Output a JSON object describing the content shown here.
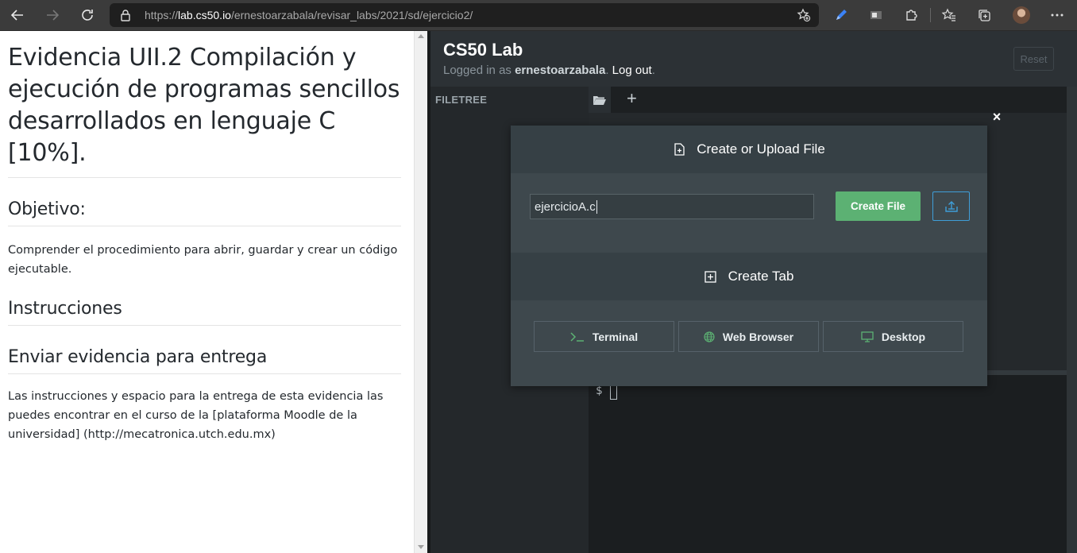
{
  "browser": {
    "url_prefix": "https://",
    "url_host": "lab.cs50.io",
    "url_path": "/ernestoarzabala/revisar_labs/2021/sd/ejercicio2/"
  },
  "doc": {
    "title": "Evidencia UII.2 Compilación y ejecución de programas sencillos desarrollados en lenguaje C [10%].",
    "objective_heading": "Objetivo:",
    "objective_text": "Comprender el procedimiento para abrir, guardar y crear un código ejecutable.",
    "instructions_heading": "Instrucciones",
    "submit_heading": "Enviar evidencia para entrega",
    "submit_text": "Las instrucciones y espacio para la entrega de esta evidencia las puedes encontrar en el curso de la [plataforma Moodle de la universidad] (http://mecatronica.utch.edu.mx)"
  },
  "ide": {
    "title": "CS50 Lab",
    "logged_in_prefix": "Logged in as ",
    "username": "ernestoarzabala",
    "logout": "Log out",
    "reset": "Reset",
    "filetree_label": "FILETREE",
    "add_tab": "+",
    "prompt": "$"
  },
  "modal": {
    "close": "×",
    "upload_heading": "Create or Upload File",
    "filename_value": "ejercicioA.c",
    "create_file": "Create File",
    "create_tab_heading": "Create Tab",
    "terminal": "Terminal",
    "web_browser": "Web Browser",
    "desktop": "Desktop"
  },
  "colors": {
    "create_button": "#5cb173",
    "upload_border": "#3f9ed8",
    "modal_bg": "#3b4448"
  }
}
